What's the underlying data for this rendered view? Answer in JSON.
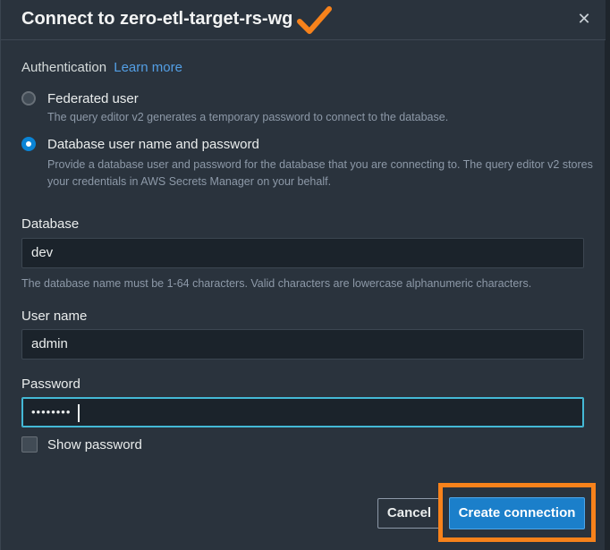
{
  "dialog": {
    "title": "Connect to zero-etl-target-rs-wg",
    "close_glyph": "✕"
  },
  "authentication": {
    "label": "Authentication",
    "learn_more": "Learn more",
    "options": [
      {
        "label": "Federated user",
        "description": "The query editor v2 generates a temporary password to connect to the database.",
        "selected": false
      },
      {
        "label": "Database user name and password",
        "description": "Provide a database user and password for the database that you are connecting to. The query editor v2 stores your credentials in AWS Secrets Manager on your behalf.",
        "selected": true
      }
    ]
  },
  "database": {
    "label": "Database",
    "value": "dev",
    "hint": "The database name must be 1-64 characters. Valid characters are lowercase alphanumeric characters."
  },
  "username": {
    "label": "User name",
    "value": "admin"
  },
  "password": {
    "label": "Password",
    "masked_value": "••••••••"
  },
  "show_password": {
    "label": "Show password",
    "checked": false
  },
  "footer": {
    "cancel_label": "Cancel",
    "create_label": "Create connection"
  },
  "colors": {
    "annotation": "#f7821b",
    "primary": "#1b7fca",
    "link": "#539fe5"
  },
  "icons": {
    "close": "close-icon",
    "annotation_check": "checkmark-icon"
  }
}
